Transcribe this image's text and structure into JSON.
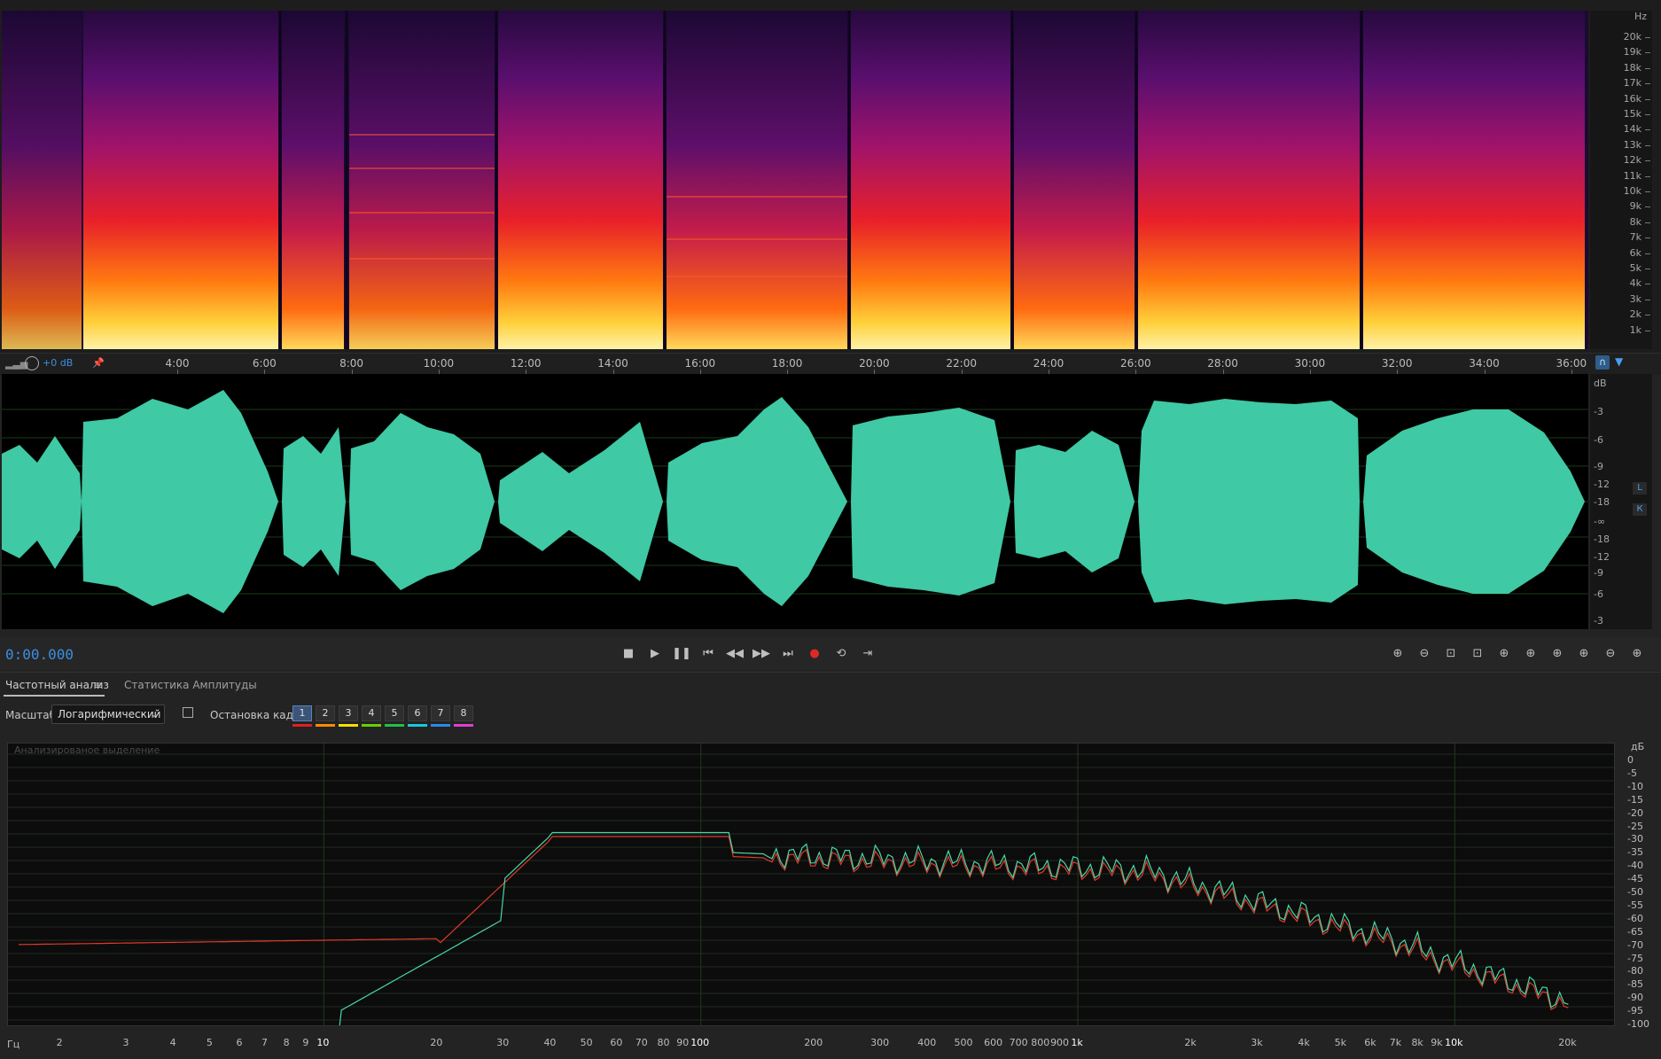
{
  "spectrogram": {
    "hz_unit": "Hz",
    "hz_labels": [
      "20k",
      "19k",
      "18k",
      "17k",
      "16k",
      "15k",
      "14k",
      "13k",
      "12k",
      "11k",
      "10k",
      "9k",
      "8k",
      "7k",
      "6k",
      "5k",
      "4k",
      "3k",
      "2k",
      "1k"
    ]
  },
  "time_ruler": {
    "gain": "+0 dB",
    "labels": [
      "4:00",
      "6:00",
      "8:00",
      "10:00",
      "12:00",
      "14:00",
      "16:00",
      "18:00",
      "20:00",
      "22:00",
      "24:00",
      "26:00",
      "28:00",
      "30:00",
      "32:00",
      "34:00",
      "36:00"
    ]
  },
  "waveform": {
    "db_unit": "dB",
    "db_labels": [
      "-3",
      "-6",
      "-9",
      "-12",
      "-18",
      "-∞",
      "-18",
      "-12",
      "-9",
      "-6",
      "-3"
    ],
    "channel_left": "L",
    "channel_right": "К",
    "color": "#3fc9a4"
  },
  "transport": {
    "timecode": "0:00.000",
    "stop_icon": "■",
    "play_icon": "▶",
    "pause_icon": "❚❚",
    "to_start_icon": "⏮",
    "rewind_icon": "◀◀",
    "forward_icon": "▶▶",
    "to_end_icon": "⏭",
    "record_icon": "●",
    "loop_icon": "⟲",
    "skip_icon": "⇥",
    "zoom_icons": [
      "⊕",
      "⊖",
      "⊡",
      "⊡",
      "⊕",
      "⊕",
      "⊕",
      "⊕",
      "⊖",
      "⊕"
    ]
  },
  "analysis": {
    "tabs": [
      "Частотный анализ",
      "Статистика Амплитуды"
    ],
    "menu_icon": "≡",
    "scale_label": "Масштаб:",
    "scale_value": "Логарифмический",
    "freeze_label": "Остановка кадра:",
    "frames": [
      "1",
      "2",
      "3",
      "4",
      "5",
      "6",
      "7",
      "8"
    ],
    "frame_colors": [
      "#e02020",
      "#ff8a00",
      "#f3e000",
      "#66d000",
      "#22c04a",
      "#18c8e0",
      "#2a8be8",
      "#e040d0"
    ],
    "graph_title": "Анализированое выделение",
    "db_unit": "дБ",
    "db_labels": [
      "0",
      "-5",
      "-10",
      "-15",
      "-20",
      "-25",
      "-30",
      "-35",
      "-40",
      "-45",
      "-50",
      "-55",
      "-60",
      "-65",
      "-70",
      "-75",
      "-80",
      "-85",
      "-90",
      "-95",
      "-100"
    ],
    "freq_unit": "Гц",
    "freq_labels": [
      "2",
      "3",
      "4",
      "5",
      "6",
      "7",
      "8",
      "9",
      "10",
      "20",
      "30",
      "40",
      "50",
      "60",
      "70",
      "80",
      "90",
      "100",
      "200",
      "300",
      "400",
      "500",
      "600",
      "700",
      "800",
      "900",
      "1k",
      "2k",
      "3k",
      "4k",
      "5k",
      "6k",
      "7k",
      "8k",
      "9k",
      "10k",
      "20k"
    ],
    "series_colors": [
      "#e03a2a",
      "#47d8a8"
    ]
  }
}
